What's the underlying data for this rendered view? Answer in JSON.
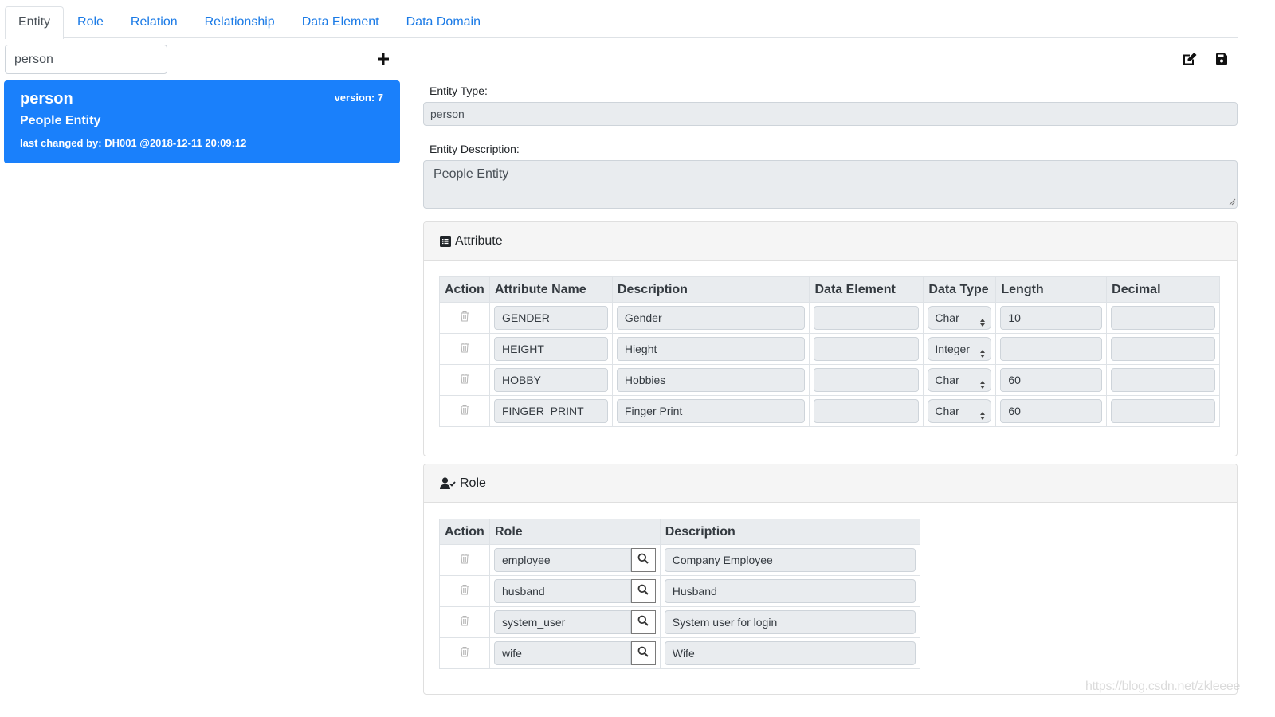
{
  "tabs": [
    {
      "label": "Entity",
      "active": true
    },
    {
      "label": "Role"
    },
    {
      "label": "Relation"
    },
    {
      "label": "Relationship"
    },
    {
      "label": "Data Element"
    },
    {
      "label": "Data Domain"
    }
  ],
  "sidebar": {
    "search_value": "person",
    "add_icon": "plus-icon",
    "entities": [
      {
        "name": "person",
        "version": "version: 7",
        "description": "People Entity",
        "last_changed": "last changed by: DH001 @2018-12-11 20:09:12"
      }
    ],
    "accent_color": "#1a80fb"
  },
  "toolbar": {
    "edit_icon": "edit-icon",
    "save_icon": "save-icon"
  },
  "form": {
    "entity_type_label": "Entity Type:",
    "entity_type_value": "person",
    "entity_description_label": "Entity Description:",
    "entity_description_value": "People Entity"
  },
  "attribute_panel": {
    "title": "Attribute",
    "icon": "list-alt-icon",
    "columns": [
      "Action",
      "Attribute Name",
      "Description",
      "Data Element",
      "Data Type",
      "Length",
      "Decimal"
    ],
    "rows": [
      {
        "name": "GENDER",
        "description": "Gender",
        "data_element": "",
        "data_type": "Char",
        "length": "10",
        "decimal": ""
      },
      {
        "name": "HEIGHT",
        "description": "Hieght",
        "data_element": "",
        "data_type": "Integer",
        "length": "",
        "decimal": ""
      },
      {
        "name": "HOBBY",
        "description": "Hobbies",
        "data_element": "",
        "data_type": "Char",
        "length": "60",
        "decimal": ""
      },
      {
        "name": "FINGER_PRINT",
        "description": "Finger Print",
        "data_element": "",
        "data_type": "Char",
        "length": "60",
        "decimal": ""
      }
    ]
  },
  "role_panel": {
    "title": "Role",
    "icon": "user-check-icon",
    "columns": [
      "Action",
      "Role",
      "Description"
    ],
    "rows": [
      {
        "role": "employee",
        "description": "Company Employee"
      },
      {
        "role": "husband",
        "description": "Husband"
      },
      {
        "role": "system_user",
        "description": "System user for login"
      },
      {
        "role": "wife",
        "description": "Wife"
      }
    ]
  },
  "watermark": "https://blog.csdn.net/zkleeee"
}
